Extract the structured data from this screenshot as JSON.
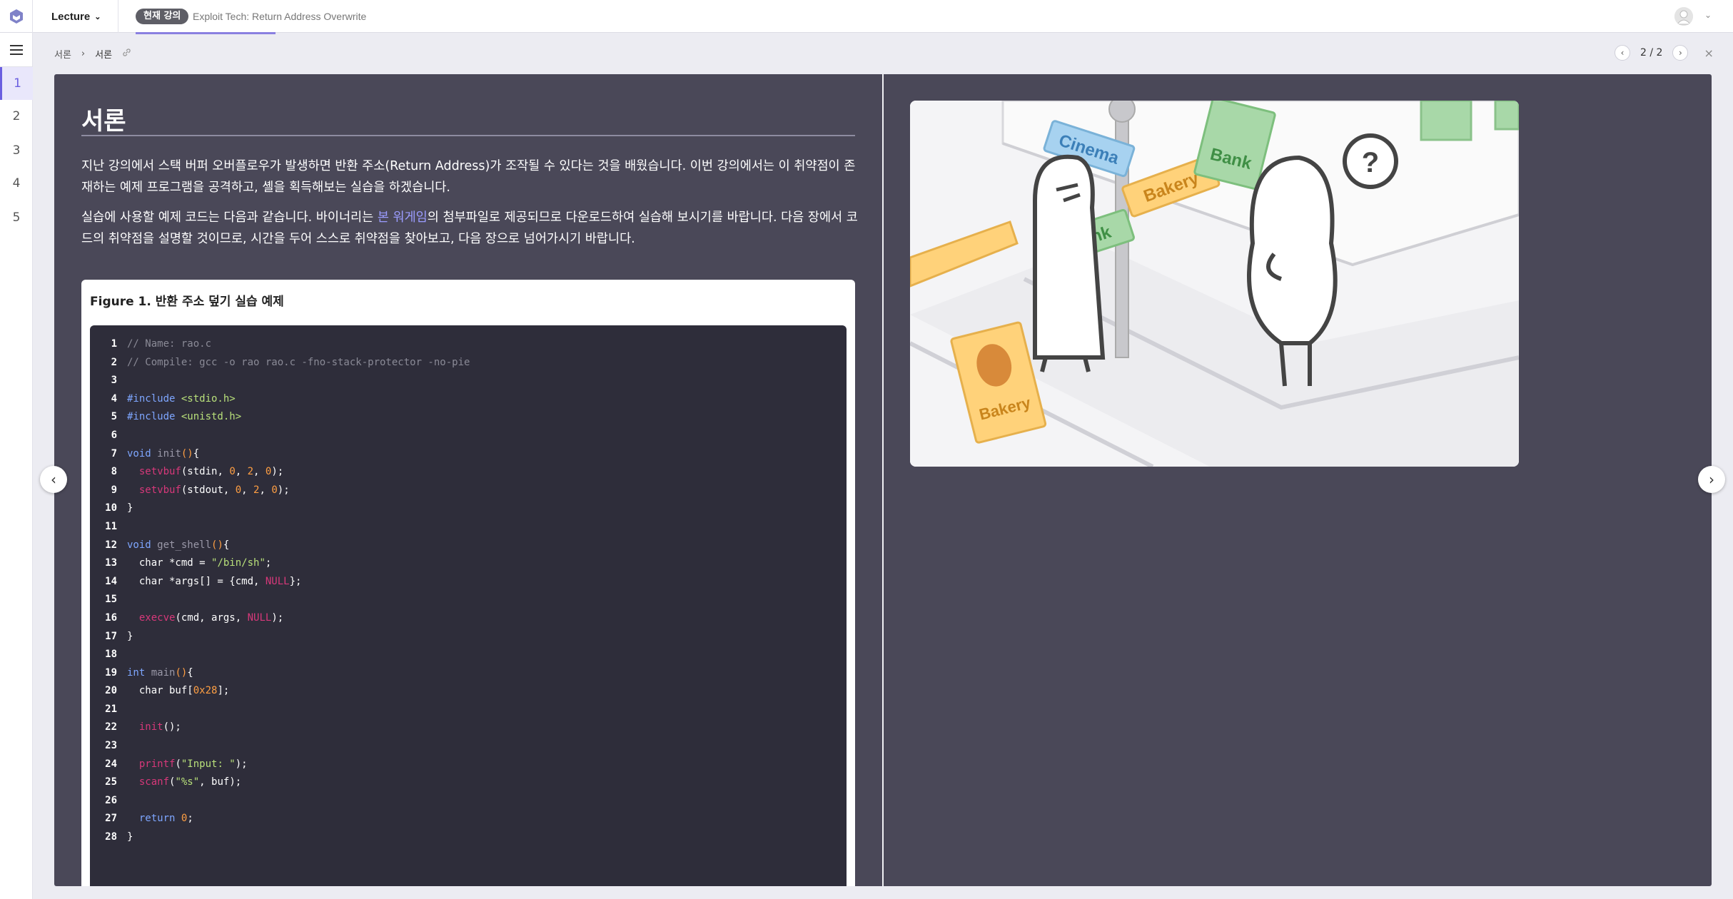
{
  "header": {
    "lecture_menu": "Lecture",
    "current_badge": "현재 강의",
    "lecture_title": "Exploit Tech: Return Address Overwrite",
    "progress": 0.25
  },
  "rail": {
    "pages": [
      "1",
      "2",
      "3",
      "4",
      "5"
    ],
    "active_page": "1"
  },
  "breadcrumb": {
    "parent": "서론",
    "current": "서론"
  },
  "pager": {
    "indicator": "2 / 2"
  },
  "slide": {
    "title": "서론",
    "para1": "지난 강의에서 스택 버퍼 오버플로우가 발생하면 반환 주소(Return Address)가 조작될 수 있다는 것을 배웠습니다. 이번 강의에서는 이 취약점이 존재하는 예제 프로그램을 공격하고, 셸을 획득해보는 실습을 하겠습니다.",
    "para2_before": "실습에 사용할 예제 코드는 다음과 같습니다. 바이너리는 ",
    "para2_link": "본 워게임",
    "para2_after": "의 첨부파일로 제공되므로 다운로드하여 실습해 보시기를 바랍니다. 다음 장에서 코드의 취약점을 설명할 것이므로, 시간을 두어 스스로 취약점을 찾아보고, 다음 장으로 넘어가시기 바랍니다.",
    "figure_caption": "Figure 1. 반환 주소 덮기 실습 예제"
  },
  "code_lines": [
    [
      [
        "cm",
        "// Name: rao.c"
      ]
    ],
    [
      [
        "cm",
        "// Compile: gcc -o rao rao.c -fno-stack-protector -no-pie"
      ]
    ],
    [],
    [
      [
        "pp",
        "#include "
      ],
      [
        "inc",
        "<stdio.h>"
      ]
    ],
    [
      [
        "pp",
        "#include "
      ],
      [
        "inc",
        "<unistd.h>"
      ]
    ],
    [],
    [
      [
        "kw",
        "void "
      ],
      [
        "fd",
        "init"
      ],
      [
        "num",
        "()"
      ],
      [
        "",
        "{"
      ]
    ],
    [
      [
        "",
        "  "
      ],
      [
        "fn",
        "setvbuf"
      ],
      [
        "",
        "(stdin, "
      ],
      [
        "num",
        "0"
      ],
      [
        "",
        ", "
      ],
      [
        "num",
        "2"
      ],
      [
        "",
        ", "
      ],
      [
        "num",
        "0"
      ],
      [
        "",
        ");"
      ]
    ],
    [
      [
        "",
        "  "
      ],
      [
        "fn",
        "setvbuf"
      ],
      [
        "",
        "(stdout, "
      ],
      [
        "num",
        "0"
      ],
      [
        "",
        ", "
      ],
      [
        "num",
        "2"
      ],
      [
        "",
        ", "
      ],
      [
        "num",
        "0"
      ],
      [
        "",
        ");"
      ]
    ],
    [
      [
        "",
        "}"
      ]
    ],
    [],
    [
      [
        "kw",
        "void "
      ],
      [
        "fd",
        "get_shell"
      ],
      [
        "num",
        "()"
      ],
      [
        "",
        "{"
      ]
    ],
    [
      [
        "",
        "  char *cmd = "
      ],
      [
        "str",
        "\"/bin/sh\""
      ],
      [
        "",
        ";"
      ]
    ],
    [
      [
        "",
        "  char *args[] = {cmd, "
      ],
      [
        "fn",
        "NULL"
      ],
      [
        "",
        "};"
      ]
    ],
    [],
    [
      [
        "",
        "  "
      ],
      [
        "fn",
        "execve"
      ],
      [
        "",
        "(cmd, args, "
      ],
      [
        "fn",
        "NULL"
      ],
      [
        "",
        ");"
      ]
    ],
    [
      [
        "",
        "}"
      ]
    ],
    [],
    [
      [
        "kw",
        "int "
      ],
      [
        "fd",
        "main"
      ],
      [
        "num",
        "()"
      ],
      [
        "",
        "{"
      ]
    ],
    [
      [
        "",
        "  char buf["
      ],
      [
        "num",
        "0x28"
      ],
      [
        "",
        "];"
      ]
    ],
    [],
    [
      [
        "",
        "  "
      ],
      [
        "fn",
        "init"
      ],
      [
        "",
        "();"
      ]
    ],
    [],
    [
      [
        "",
        "  "
      ],
      [
        "fn",
        "printf"
      ],
      [
        "",
        "("
      ],
      [
        "str",
        "\"Input: \""
      ],
      [
        "",
        ");"
      ]
    ],
    [
      [
        "",
        "  "
      ],
      [
        "fn",
        "scanf"
      ],
      [
        "",
        "("
      ],
      [
        "str",
        "\"%s\""
      ],
      [
        "",
        ", buf);"
      ]
    ],
    [],
    [
      [
        "",
        "  "
      ],
      [
        "kw",
        "return "
      ],
      [
        "num",
        "0"
      ],
      [
        "",
        ";"
      ]
    ],
    [
      [
        "",
        "}"
      ]
    ]
  ],
  "illustration": {
    "signs": [
      "Cinema",
      "Bakery",
      "Bank",
      "Bank",
      "Bakery"
    ],
    "thought": "?"
  },
  "colors": {
    "accent": "#6b5fe0",
    "slide_bg": "#4a4858",
    "code_bg": "#2e2d3a"
  },
  "icons": [
    "logo-icon",
    "chevron-down-icon",
    "avatar-icon",
    "menu-icon",
    "link-icon",
    "chevron-left-icon",
    "chevron-right-icon",
    "close-icon"
  ]
}
